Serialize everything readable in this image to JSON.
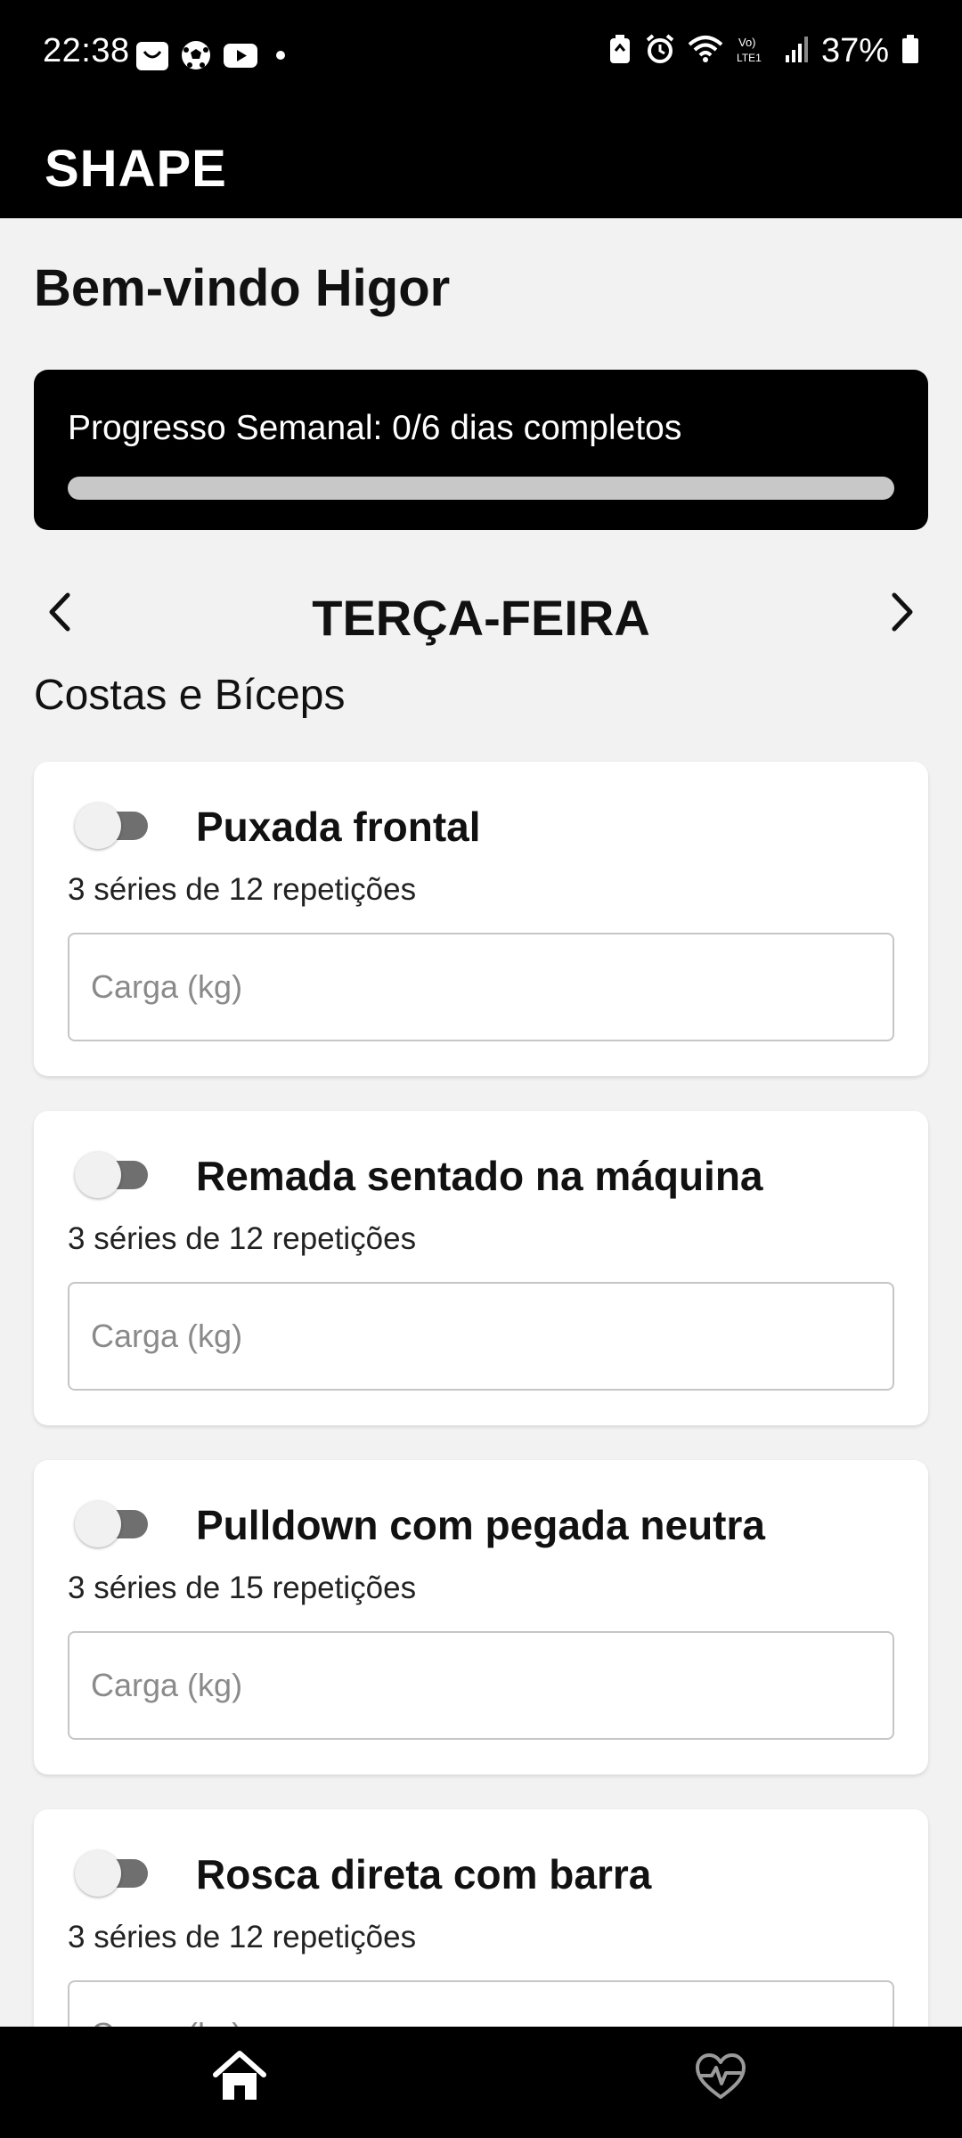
{
  "status_bar": {
    "time": "22:38",
    "battery": "37%",
    "left_icons": [
      "shopping-bag-icon",
      "soccer-ball-icon",
      "youtube-icon",
      "dot-icon"
    ],
    "right_icons": [
      "battery-saver-icon",
      "alarm-icon",
      "wifi-icon",
      "volte-icon",
      "signal-icon",
      "battery-icon"
    ]
  },
  "app_bar": {
    "title": "SHAPE"
  },
  "main": {
    "welcome": "Bem-vindo Higor",
    "progress": {
      "label": "Progresso Semanal: 0/6 dias completos",
      "completed": 0,
      "total": 6,
      "fraction": 0
    },
    "day_nav": {
      "day": "TERÇA-FEIRA",
      "prev_icon": "chevron-left-icon",
      "next_icon": "chevron-right-icon"
    },
    "workout_name": "Costas e Bíceps",
    "exercises": [
      {
        "name": "Puxada frontal",
        "sets": "3 séries de 12 repetições",
        "placeholder": "Carga (kg)",
        "value": "",
        "done": false
      },
      {
        "name": "Remada sentado na máquina",
        "sets": "3 séries de 12 repetições",
        "placeholder": "Carga (kg)",
        "value": "",
        "done": false
      },
      {
        "name": "Pulldown com pegada neutra",
        "sets": "3 séries de 15 repetições",
        "placeholder": "Carga (kg)",
        "value": "",
        "done": false
      },
      {
        "name": "Rosca direta com barra",
        "sets": "3 séries de 12 repetições",
        "placeholder": "Carga (kg)",
        "value": "",
        "done": false
      }
    ]
  },
  "bottom_nav": {
    "tabs": [
      {
        "icon": "home-icon",
        "active": true
      },
      {
        "icon": "heart-pulse-icon",
        "active": false
      }
    ]
  },
  "colors": {
    "bar_bg": "#000000",
    "page_bg": "#f2f2f2",
    "track": "#c8c8c8",
    "toggle_track": "#6f6f6f",
    "inactive_tab": "#9a9a9a"
  }
}
